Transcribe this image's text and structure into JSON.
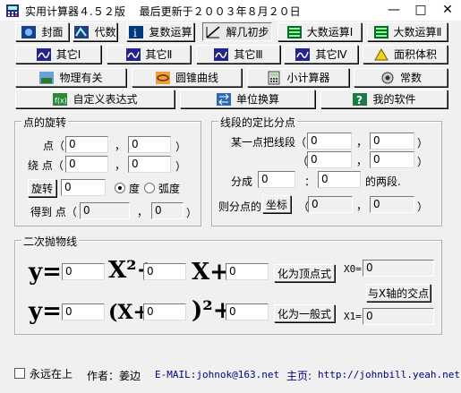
{
  "window": {
    "title": "实用计算器４.５２版　 最后更新于２００３年８月２０日",
    "minimize": "—",
    "maximize": "□",
    "close": "✕"
  },
  "toolbar": {
    "row1": [
      {
        "label": "封面",
        "icon": "cover-icon"
      },
      {
        "label": "代数",
        "icon": "algebra-icon"
      },
      {
        "label": "复数运算",
        "icon": "complex-icon"
      },
      {
        "label": "解几初步",
        "icon": "geometry-icon"
      },
      {
        "label": "大数运算Ⅰ",
        "icon": "bignum-icon"
      },
      {
        "label": "大数运算Ⅱ",
        "icon": "bignum-icon"
      }
    ],
    "row2": [
      {
        "label": "其它Ⅰ",
        "icon": "other-icon"
      },
      {
        "label": "其它Ⅱ",
        "icon": "other-icon"
      },
      {
        "label": "其它Ⅲ",
        "icon": "other-icon"
      },
      {
        "label": "其它Ⅳ",
        "icon": "other-icon"
      },
      {
        "label": "面积体积",
        "icon": "area-volume-icon"
      }
    ],
    "row3": [
      {
        "label": "物理有关",
        "icon": "physics-icon"
      },
      {
        "label": "圆锥曲线",
        "icon": "conic-icon"
      },
      {
        "label": "小计算器",
        "icon": "calculator-icon"
      },
      {
        "label": "常数",
        "icon": "constant-icon"
      }
    ],
    "row4": [
      {
        "label": "自定义表达式",
        "icon": "formula-icon"
      },
      {
        "label": "单位换算",
        "icon": "unit-icon"
      },
      {
        "label": "我的软件",
        "icon": "help-icon"
      }
    ]
  },
  "rotation": {
    "title": "点的旋转",
    "point_label": "点（",
    "around_label": "绕 点（",
    "comma": "，",
    "close_paren": "）",
    "px": "0",
    "py": "0",
    "cx": "0",
    "cy": "0",
    "rotate_button": "旋转",
    "angle": "0",
    "degree_label": "度",
    "radian_label": "弧度",
    "result_label": "得到 点（",
    "rx": "0",
    "ry": "0"
  },
  "division": {
    "title": "线段的定比分点",
    "segment_label": "某一点把线段（",
    "ax": "0",
    "ay": "0",
    "bx": "0",
    "by": "0",
    "comma": "，",
    "close_paren": "）",
    "split_label": "分成",
    "ratio_a": "0",
    "colon": "：",
    "ratio_b": "0",
    "parts_label": "的两段.",
    "result_label": "则分点的",
    "coord_button": "坐标",
    "open_paren": "（",
    "rx": "0",
    "ry": "0"
  },
  "parabola": {
    "title": "二次抛物线",
    "y1": "y=",
    "x2": "X²+",
    "x1": "X+",
    "a": "0",
    "b": "0",
    "c": "0",
    "to_vertex_button": "化为顶点式",
    "x0_label": "X0=",
    "x0": "0",
    "intersect_button": "与X轴的交点",
    "y2": "y=",
    "open": "(X+",
    "close_sq": ")²+",
    "d": "0",
    "e": "0",
    "f": "0",
    "to_general_button": "化为一般式",
    "x1_label": "X1=",
    "x1v": "0"
  },
  "footer": {
    "always_on_top": "永远在上",
    "author": "作者：姜边",
    "email": "E-MAIL:johnok@163.net",
    "homepage_label": "主页:",
    "homepage": "http://johnbill.yeah.net"
  }
}
